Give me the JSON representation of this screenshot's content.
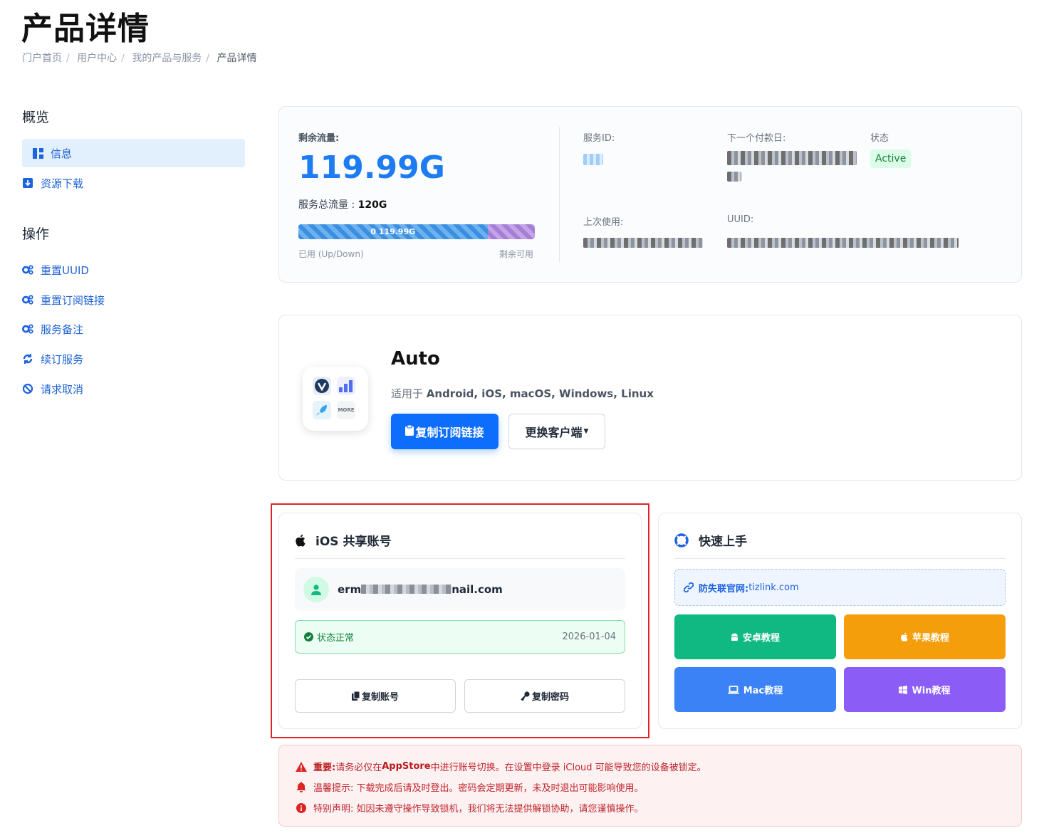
{
  "page": {
    "title": "产品详情"
  },
  "breadcrumb": [
    "门户首页",
    "用户中心",
    "我的产品与服务",
    "产品详情"
  ],
  "sidebar": {
    "overview_heading": "概览",
    "overview_items": [
      {
        "label": "信息",
        "icon": "dashboard-icon",
        "active": true
      },
      {
        "label": "资源下载",
        "icon": "download-icon",
        "active": false
      }
    ],
    "actions_heading": "操作",
    "action_items": [
      {
        "label": "重置UUID",
        "icon": "gears-icon"
      },
      {
        "label": "重置订阅链接",
        "icon": "gears-icon"
      },
      {
        "label": "服务备注",
        "icon": "gears-icon"
      },
      {
        "label": "续订服务",
        "icon": "renew-icon"
      },
      {
        "label": "请求取消",
        "icon": "ban-icon"
      }
    ]
  },
  "traffic": {
    "remaining_label": "剩余流量:",
    "remaining_value": "119.99G",
    "total_label": "服务总流量 : ",
    "total_value": "120G",
    "bar_text": "0 119.99G",
    "used_fraction": 0.8,
    "used_label": "已用 (Up/Down)",
    "left_label": "剩余可用"
  },
  "service": {
    "id_label": "服务ID:",
    "next_pay_label": "下一个付款日:",
    "status_label": "状态",
    "status_value": "Active",
    "last_used_label": "上次使用:",
    "uuid_label": "UUID:"
  },
  "client": {
    "name": "Auto",
    "os_prefix": "适用于 ",
    "os_list": "Android, iOS, macOS, Windows, Linux",
    "copy_button": "复制订阅链接",
    "switch_button": "更换客户端",
    "icon_more": "MORE"
  },
  "ios_account": {
    "heading": "iOS 共享账号",
    "email_start": "erm",
    "email_end": "nail.com",
    "status_text": "状态正常",
    "status_date": "2026-01-04",
    "copy_account": "复制账号",
    "copy_password": "复制密码"
  },
  "quickstart": {
    "heading": "快速上手",
    "link_label": "防失联官网: ",
    "link_value": "tizlink.com",
    "tutorials": [
      {
        "label": "安卓教程",
        "color": "#10b981",
        "icon": "android-icon"
      },
      {
        "label": "苹果教程",
        "color": "#f59e0b",
        "icon": "apple-icon"
      },
      {
        "label": "Mac教程",
        "color": "#3b82f6",
        "icon": "laptop-icon"
      },
      {
        "label": "Win教程",
        "color": "#8b5cf6",
        "icon": "windows-icon"
      }
    ]
  },
  "alerts": {
    "important_label": "重要:",
    "important_pre": " 请务必仅在 ",
    "important_bold": "AppStore",
    "important_post": " 中进行账号切换。在设置中登录 iCloud 可能导致您的设备被锁定。",
    "tip": "温馨提示: 下载完成后请及时登出。密码会定期更新，未及时退出可能影响使用。",
    "notice": "特别声明: 如因未遵守操作导致锁机，我们将无法提供解锁协助，请您谨慎操作。"
  },
  "colors": {
    "accent": "#0d6efd",
    "link": "#1d63e0",
    "success": "#15803d",
    "danger": "#c0262d"
  }
}
